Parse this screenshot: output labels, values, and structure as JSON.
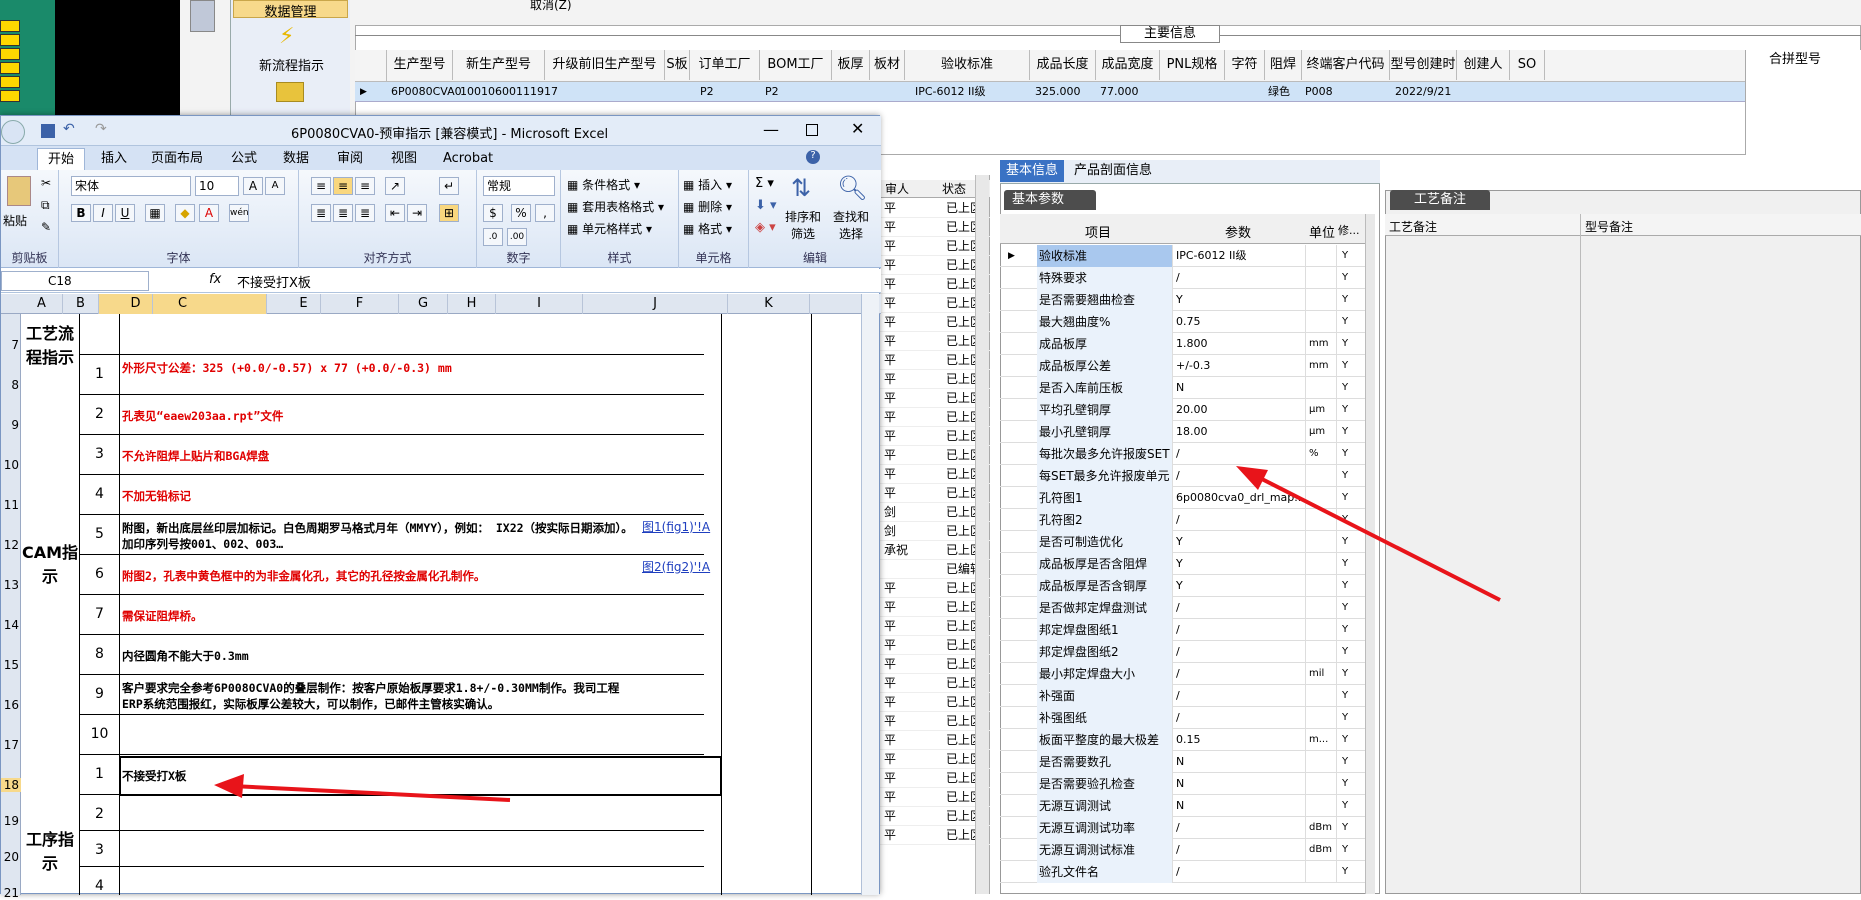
{
  "back_app": {
    "nav": {
      "data_mgmt": "数据管理",
      "new_flow": "新流程指示"
    },
    "top_cancel": "取消(Z)",
    "main_info_title": "主要信息",
    "grid_headers": [
      "生产型号",
      "新生产型号",
      "升级前旧生产型号",
      "S板",
      "订单工厂",
      "BOM工厂",
      "板厚",
      "板材",
      "验收标准",
      "成品长度",
      "成品宽度",
      "PNL规格",
      "字符",
      "阻焊",
      "终端客户代码",
      "型号创建时间",
      "创建人",
      "SO"
    ],
    "grid_row": {
      "prod": "6P0080CVA0",
      "newprod": "10010600111917",
      "order_factory": "P2",
      "bom_factory": "P2",
      "standard": "IPC-6012 II级",
      "length": "325.000",
      "width": "77.000",
      "mask": "绿色",
      "client": "P008",
      "created": "2022/9/21"
    },
    "merge_header": "合拼型号",
    "side_list_headers": [
      "审人",
      "状态"
    ],
    "side_list_rows": [
      [
        "平",
        "已上区"
      ],
      [
        "平",
        "已上区"
      ],
      [
        "平",
        "已上区"
      ],
      [
        "平",
        "已上区"
      ],
      [
        "平",
        "已上区"
      ],
      [
        "平",
        "已上区"
      ],
      [
        "平",
        "已上区"
      ],
      [
        "平",
        "已上区"
      ],
      [
        "平",
        "已上区"
      ],
      [
        "平",
        "已上区"
      ],
      [
        "平",
        "已上区"
      ],
      [
        "平",
        "已上区"
      ],
      [
        "平",
        "已上区"
      ],
      [
        "平",
        "已上区"
      ],
      [
        "平",
        "已上区"
      ],
      [
        "平",
        "已上区"
      ],
      [
        "剑",
        "已上区"
      ],
      [
        "剑",
        "已上区"
      ],
      [
        "承祝",
        "已上区"
      ],
      [
        "",
        "已编辑"
      ],
      [
        "平",
        "已上区"
      ],
      [
        "平",
        "已上区"
      ],
      [
        "平",
        "已上区"
      ],
      [
        "平",
        "已上区"
      ],
      [
        "平",
        "已上区"
      ],
      [
        "平",
        "已上区"
      ],
      [
        "平",
        "已上区"
      ],
      [
        "平",
        "已上区"
      ],
      [
        "平",
        "已上区"
      ],
      [
        "平",
        "已上区"
      ],
      [
        "平",
        "已上区"
      ],
      [
        "平",
        "已上区"
      ],
      [
        "平",
        "已上区"
      ],
      [
        "平",
        "已上区"
      ]
    ]
  },
  "props": {
    "tabs": [
      "基本信息",
      "产品剖面信息"
    ],
    "subtab": "基本参数",
    "headers": [
      "项目",
      "参数",
      "单位",
      "修..."
    ],
    "rows": [
      [
        "验收标准",
        "IPC-6012 II级",
        "",
        "Y"
      ],
      [
        "特殊要求",
        "/",
        "",
        "Y"
      ],
      [
        "是否需要翘曲检查",
        "Y",
        "",
        "Y"
      ],
      [
        "最大翘曲度%",
        "0.75",
        "",
        "Y"
      ],
      [
        "成品板厚",
        "1.800",
        "mm",
        "Y"
      ],
      [
        "成品板厚公差",
        "+/-0.3",
        "mm",
        "Y"
      ],
      [
        "是否入库前压板",
        "N",
        "",
        "Y"
      ],
      [
        "平均孔壁铜厚",
        "20.00",
        "μm",
        "Y"
      ],
      [
        "最小孔壁铜厚",
        "18.00",
        "μm",
        "Y"
      ],
      [
        "每批次最多允许报废SET",
        "/",
        "%",
        "Y"
      ],
      [
        "每SET最多允许报废单元",
        "/",
        "",
        "Y"
      ],
      [
        "孔符图1",
        "6p0080cva0_drl_map...",
        "",
        "Y"
      ],
      [
        "孔符图2",
        "/",
        "",
        "Y"
      ],
      [
        "是否可制造优化",
        "Y",
        "",
        "Y"
      ],
      [
        "成品板厚是否含阻焊",
        "Y",
        "",
        "Y"
      ],
      [
        "成品板厚是否含铜厚",
        "Y",
        "",
        "Y"
      ],
      [
        "是否做邦定焊盘测试",
        "/",
        "",
        "Y"
      ],
      [
        "邦定焊盘图纸1",
        "/",
        "",
        "Y"
      ],
      [
        "邦定焊盘图纸2",
        "/",
        "",
        "Y"
      ],
      [
        "最小邦定焊盘大小",
        "/",
        "mil",
        "Y"
      ],
      [
        "补强面",
        "/",
        "",
        "Y"
      ],
      [
        "补强图纸",
        "/",
        "",
        "Y"
      ],
      [
        "板面平整度的最大极差",
        "0.15",
        "m...",
        "Y"
      ],
      [
        "是否需要数孔",
        "N",
        "",
        "Y"
      ],
      [
        "是否需要验孔检查",
        "N",
        "",
        "Y"
      ],
      [
        "无源互调测试",
        "N",
        "",
        "Y"
      ],
      [
        "无源互调测试功率",
        "/",
        "dBm",
        "Y"
      ],
      [
        "无源互调测试标准",
        "/",
        "dBm",
        "Y"
      ],
      [
        "验孔文件名",
        "/",
        "",
        "Y"
      ]
    ]
  },
  "craft": {
    "tab": "工艺备注",
    "col1": "工艺备注",
    "col2": "型号备注"
  },
  "excel": {
    "title": "6P0080CVA0-预审指示  [兼容模式] - Microsoft Excel",
    "tabs": [
      "开始",
      "插入",
      "页面布局",
      "公式",
      "数据",
      "审阅",
      "视图",
      "Acrobat"
    ],
    "ribbon": {
      "paste": "粘贴",
      "clipboard": "剪贴板",
      "font_name": "宋体",
      "font_size": "10",
      "font_group": "字体",
      "align_group": "对齐方式",
      "num_format": "常规",
      "number_group": "数字",
      "cond_format": "条件格式",
      "table_format": "套用表格格式",
      "cell_style": "单元格样式",
      "style_group": "样式",
      "insert": "插入",
      "delete": "删除",
      "format": "格式",
      "cells_group": "单元格",
      "sort": "排序和\n筛选",
      "find": "查找和\n选择",
      "edit_group": "编辑",
      "percent": "%"
    },
    "name_box": "C18",
    "formula": "不接受打X板",
    "columns": [
      "A",
      "B",
      "C",
      "D",
      "E",
      "F",
      "G",
      "H",
      "I",
      "J",
      "K"
    ],
    "rows": [
      {
        "r": "7",
        "num": "",
        "text": "",
        "red": false
      },
      {
        "r": "8",
        "num": "1",
        "text": "外形尺寸公差：325 (+0.0/-0.57) x 77 (+0.0/-0.3) mm",
        "red": true
      },
      {
        "r": "9",
        "num": "2",
        "text": "孔表见“eaew203aa.rpt”文件",
        "red": true
      },
      {
        "r": "10",
        "num": "3",
        "text": "不允许阻焊上贴片和BGA焊盘",
        "red": true
      },
      {
        "r": "11",
        "num": "4",
        "text": "不加无铅标记",
        "red": true
      },
      {
        "r": "12",
        "num": "5",
        "text": "附图，新出底层丝印层加标记。白色周期罗马格式月年（MMYY），例如：  IX22（按实际日期添加）。加印序列号按001、002、003…",
        "red": false
      },
      {
        "r": "13",
        "num": "6",
        "text": "附图2，孔表中黄色框中的为非金属化孔，其它的孔径按金属化孔制作。",
        "red": true
      },
      {
        "r": "14",
        "num": "7",
        "text": "需保证阻焊桥。",
        "red": true
      },
      {
        "r": "15",
        "num": "8",
        "text": "内径圆角不能大于0.3mm",
        "red": false
      },
      {
        "r": "16",
        "num": "9",
        "text": "客户要求完全参考6P0080CVA0的叠层制作：按客户原始板厚要求1.8+/-0.30MM制作。我司工程ERP系统范围报红，实际板厚公差较大，可以制作，已邮件主管核实确认。",
        "red": false
      },
      {
        "r": "17",
        "num": "10",
        "text": "",
        "red": false
      },
      {
        "r": "18",
        "num": "1",
        "text": "不接受打X板",
        "red": false
      },
      {
        "r": "19",
        "num": "2",
        "text": "",
        "red": false
      },
      {
        "r": "20",
        "num": "3",
        "text": "",
        "red": false
      },
      {
        "r": "21",
        "num": "4",
        "text": "",
        "red": false
      }
    ],
    "a_labels": {
      "flow": "工艺流程指示",
      "cam": "CAM指示",
      "proc": "工序指示"
    },
    "links": {
      "fig1": "图1(fig1)'!A",
      "fig2": "图2(fig2)'!A"
    }
  }
}
